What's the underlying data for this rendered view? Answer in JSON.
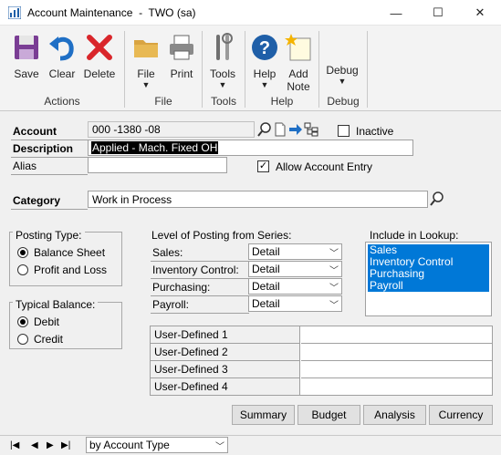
{
  "window": {
    "title": "Account Maintenance  -  TWO (sa)",
    "minimize": "—",
    "maximize": "☐",
    "close": "✕"
  },
  "ribbon": {
    "save": "Save",
    "clear": "Clear",
    "delete": "Delete",
    "file": "File",
    "print": "Print",
    "tools": "Tools",
    "help": "Help",
    "add_note_1": "Add",
    "add_note_2": "Note",
    "debug": "Debug",
    "groups": {
      "actions": "Actions",
      "file": "File",
      "tools": "Tools",
      "help": "Help",
      "debug": "Debug"
    }
  },
  "form": {
    "account_label": "Account",
    "account_value": "000 -1380 -08",
    "inactive_label": "Inactive",
    "description_label": "Description",
    "description_value": "Applied - Mach. Fixed OH",
    "alias_label": "Alias",
    "alias_value": "",
    "allow_entry_label": "Allow Account Entry",
    "category_label": "Category",
    "category_value": "Work in Process",
    "posting_type": {
      "title": "Posting Type:",
      "balance_sheet": "Balance Sheet",
      "profit_loss": "Profit and Loss",
      "selected": "Balance Sheet"
    },
    "typical_balance": {
      "title": "Typical Balance:",
      "debit": "Debit",
      "credit": "Credit",
      "selected": "Debit"
    },
    "level_of_posting": {
      "title": "Level of Posting from Series:",
      "rows": [
        {
          "label": "Sales:",
          "value": "Detail"
        },
        {
          "label": "Inventory Control:",
          "value": "Detail"
        },
        {
          "label": "Purchasing:",
          "value": "Detail"
        },
        {
          "label": "Payroll:",
          "value": "Detail"
        }
      ]
    },
    "include_in_lookup": {
      "title": "Include in Lookup:",
      "items": [
        "Sales",
        "Inventory Control",
        "Purchasing",
        "Payroll"
      ]
    },
    "user_defined": [
      {
        "label": "User-Defined 1",
        "value": ""
      },
      {
        "label": "User-Defined 2",
        "value": ""
      },
      {
        "label": "User-Defined 3",
        "value": ""
      },
      {
        "label": "User-Defined 4",
        "value": ""
      }
    ],
    "buttons": {
      "summary": "Summary",
      "budget": "Budget",
      "analysis": "Analysis",
      "currency": "Currency"
    }
  },
  "status": {
    "sort_by": "by Account Type"
  }
}
